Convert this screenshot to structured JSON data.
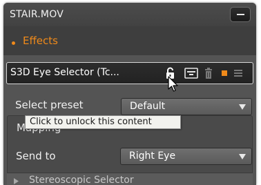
{
  "panel": {
    "title": "STAIR.MOV",
    "section_label": "Effects"
  },
  "effect": {
    "name": "S3D Eye Selector (Tc...",
    "icons": [
      "lock-icon",
      "panel-icon",
      "trash-icon",
      "color-swatch",
      "grip-icon"
    ],
    "swatch_color": "#f08a1a"
  },
  "preset": {
    "label": "Select preset",
    "value": "Default"
  },
  "tooltip": {
    "text": "Click to unlock this content"
  },
  "mapping": {
    "group_label": "Mapping",
    "send_to_label": "Send to",
    "send_to_value": "Right Eye"
  },
  "collapsed": {
    "label": "Stereoscopic Selector"
  },
  "colors": {
    "accent": "#f08a1a",
    "panel_bg": "#545454"
  }
}
